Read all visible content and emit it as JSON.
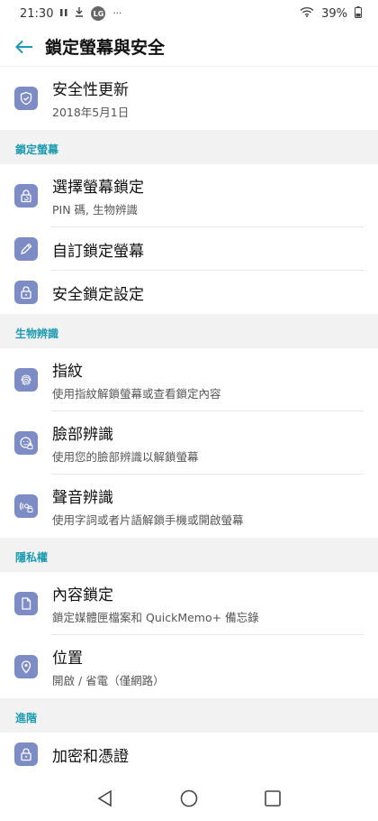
{
  "status_bar": {
    "time": "21:30",
    "lg": "LG",
    "dots": "···",
    "battery": "39%"
  },
  "app_bar": {
    "title": "鎖定螢幕與安全"
  },
  "security_update": {
    "title": "安全性更新",
    "subtitle": "2018年5月1日"
  },
  "sections": {
    "lock_screen": {
      "header": "鎖定螢幕",
      "select_lock": {
        "title": "選擇螢幕鎖定",
        "subtitle": "PIN 碼, 生物辨識"
      },
      "customize_lock": {
        "title": "自訂鎖定螢幕"
      },
      "secure_lock": {
        "title": "安全鎖定設定"
      }
    },
    "biometrics": {
      "header": "生物辨識",
      "fingerprint": {
        "title": "指紋",
        "subtitle": "使用指紋解鎖螢幕或查看鎖定內容"
      },
      "face": {
        "title": "臉部辨識",
        "subtitle": "使用您的臉部辨識以解鎖螢幕"
      },
      "voice": {
        "title": "聲音辨識",
        "subtitle": "使用字詞或者片語解鎖手機或開啟螢幕"
      }
    },
    "privacy": {
      "header": "隱私權",
      "content_lock": {
        "title": "內容鎖定",
        "subtitle": "鎖定媒體匣檔案和 QuickMemo+ 備忘錄"
      },
      "location": {
        "title": "位置",
        "subtitle": "開啟 / 省電（僅網路）"
      }
    },
    "advanced": {
      "header": "進階",
      "encryption": {
        "title": "加密和憑證"
      }
    }
  },
  "colors": {
    "accent": "#1e9bb0",
    "icon_bg": "#7d8cc4",
    "section_bg": "#f2f2f2"
  }
}
